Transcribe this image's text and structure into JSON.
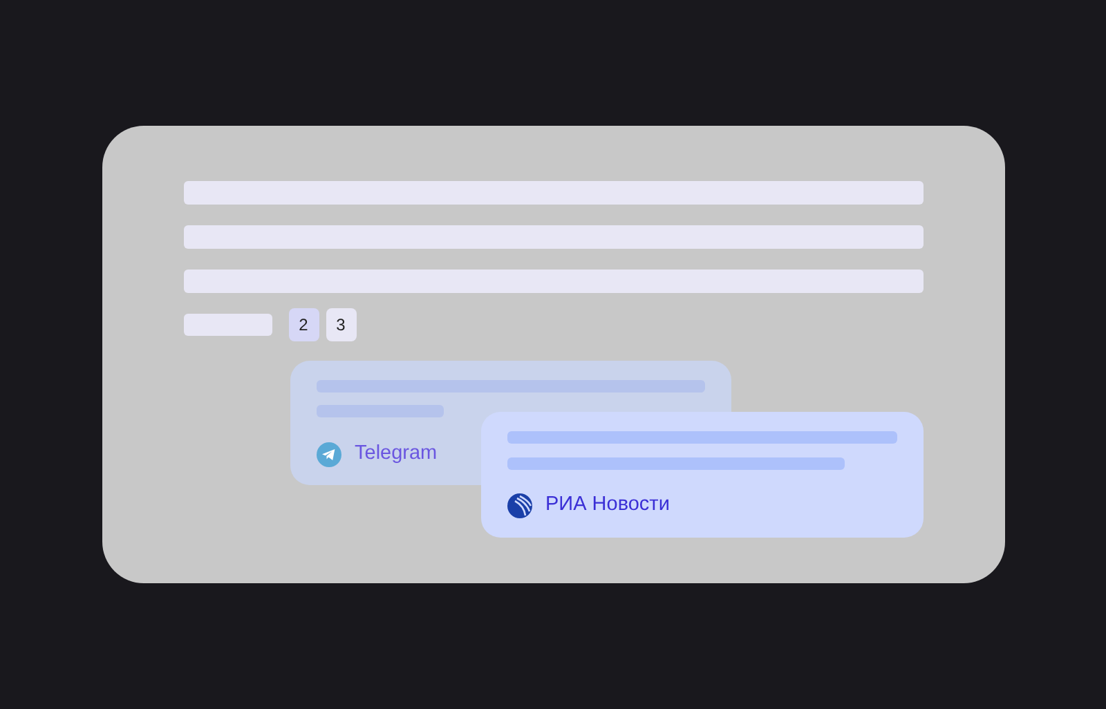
{
  "pagination": [
    {
      "label": "2",
      "selected": true
    },
    {
      "label": "3",
      "selected": false
    }
  ],
  "cards": [
    {
      "source": "Telegram",
      "kind": "telegram"
    },
    {
      "source": "РИА Новости",
      "kind": "ria"
    }
  ]
}
